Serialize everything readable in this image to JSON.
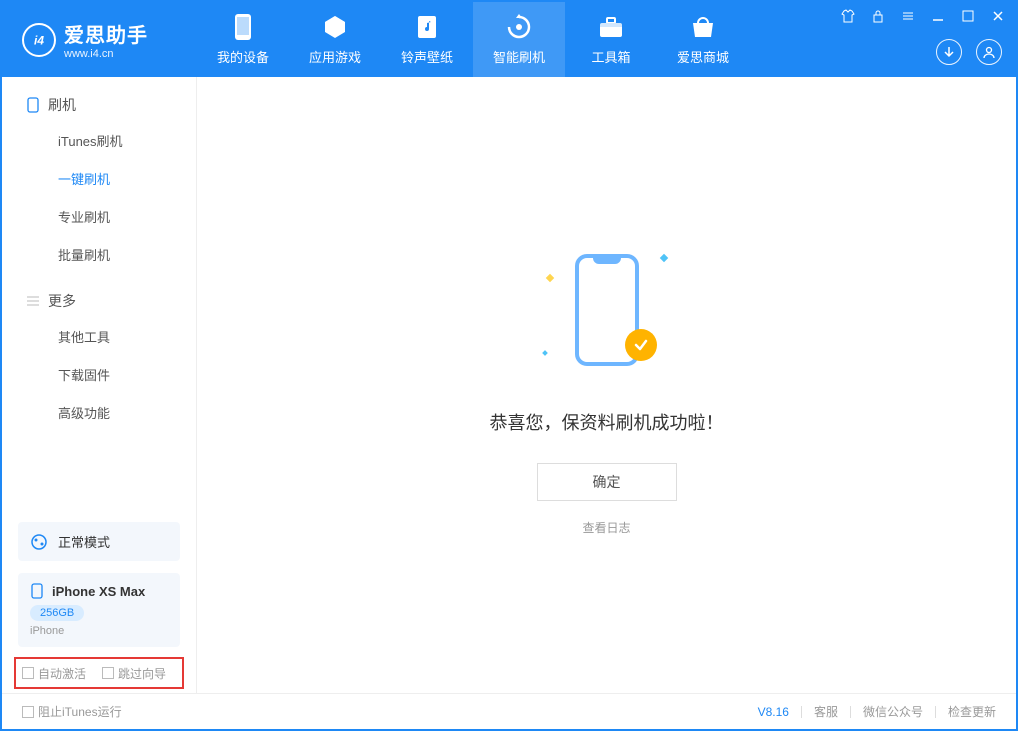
{
  "app": {
    "title": "爱思助手",
    "subtitle": "www.i4.cn"
  },
  "nav": {
    "items": [
      {
        "label": "我的设备"
      },
      {
        "label": "应用游戏"
      },
      {
        "label": "铃声壁纸"
      },
      {
        "label": "智能刷机"
      },
      {
        "label": "工具箱"
      },
      {
        "label": "爱思商城"
      }
    ]
  },
  "sidebar": {
    "sections": [
      {
        "title": "刷机",
        "items": [
          "iTunes刷机",
          "一键刷机",
          "专业刷机",
          "批量刷机"
        ]
      },
      {
        "title": "更多",
        "items": [
          "其他工具",
          "下载固件",
          "高级功能"
        ]
      }
    ],
    "mode": "正常模式",
    "device": {
      "name": "iPhone XS Max",
      "storage": "256GB",
      "type": "iPhone"
    },
    "options": {
      "autoActivate": "自动激活",
      "skipGuide": "跳过向导"
    }
  },
  "content": {
    "successMessage": "恭喜您，保资料刷机成功啦！",
    "okButton": "确定",
    "viewLog": "查看日志"
  },
  "footer": {
    "blockItunes": "阻止iTunes运行",
    "version": "V8.16",
    "links": [
      "客服",
      "微信公众号",
      "检查更新"
    ]
  }
}
